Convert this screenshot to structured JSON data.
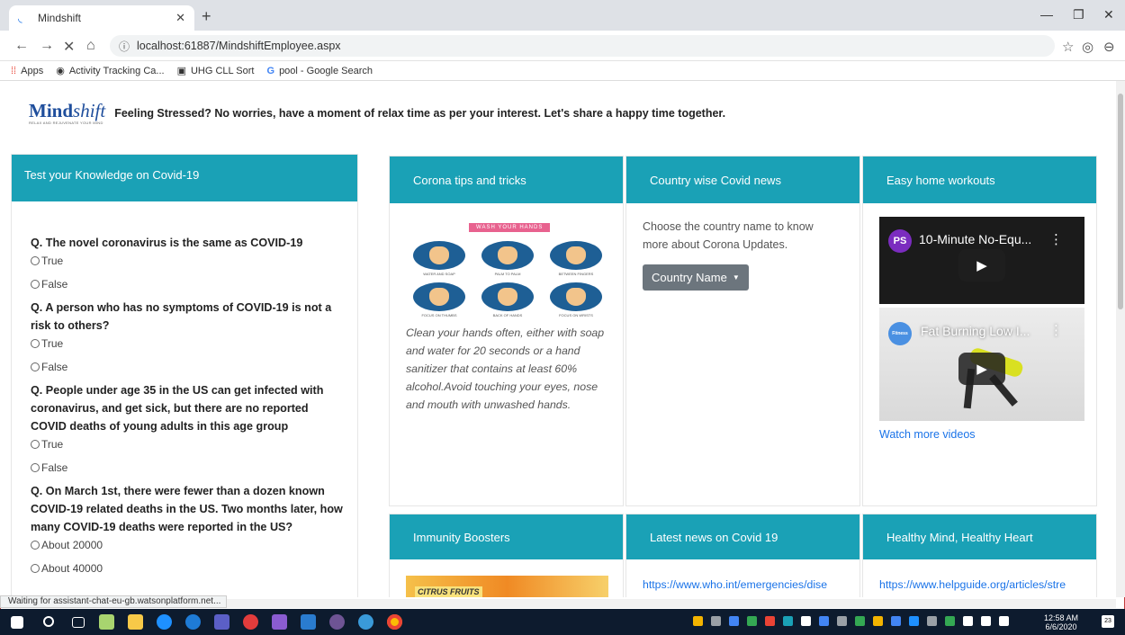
{
  "browser": {
    "tab_title": "Mindshift",
    "url": "localhost:61887/MindshiftEmployee.aspx",
    "bookmarks": [
      "Apps",
      "Activity Tracking Ca...",
      "UHG CLL Sort",
      "pool - Google Search"
    ],
    "status_text": "Waiting for assistant-chat-eu-gb.watsonplatform.net..."
  },
  "header": {
    "logo_part1": "Mind",
    "logo_part2": "shift",
    "logo_sub": "RELAX AND REJUVENATE YOUR MIND",
    "tagline": "Feeling Stressed? No worries, have a moment of relax time as per your interest. Let's share a happy time together."
  },
  "quiz": {
    "title": "Test your Knowledge on Covid-19",
    "questions": [
      {
        "text": "Q. The novel coronavirus is the same as COVID-19",
        "options": [
          "True",
          "False"
        ]
      },
      {
        "text": "Q. A person who has no symptoms of COVID-19 is not a risk to others?",
        "options": [
          "True",
          "False"
        ]
      },
      {
        "text": "Q. People under age 35 in the US can get infected with coronavirus, and get sick, but there are no reported COVID deaths of young adults in this age group",
        "options": [
          "True",
          "False"
        ]
      },
      {
        "text": "Q. On March 1st, there were fewer than a dozen known COVID-19 related deaths in the US. Two months later, how many COVID-19 deaths were reported in the US?",
        "options": [
          "About 20000",
          "About 40000"
        ]
      }
    ]
  },
  "tips": {
    "title": "Corona tips and tricks",
    "banner": "WASH YOUR HANDS",
    "captions": [
      "WATER AND SOAP",
      "PALM TO PALM",
      "BETWEEN FINGERS",
      "FOCUS ON THUMBS",
      "BACK OF HANDS",
      "FOCUS ON WRISTS"
    ],
    "text": "Clean your hands often, either with soap and water for 20 seconds or a hand sanitizer that contains at least 60% alcohol.Avoid touching your eyes, nose and mouth with unwashed hands."
  },
  "news": {
    "title": "Country wise Covid news",
    "text": "Choose the country name to know more about Corona Updates.",
    "dropdown": "Country Name"
  },
  "workouts": {
    "title": "Easy home workouts",
    "video1": {
      "badge": "PS",
      "title": "10-Minute No-Equ..."
    },
    "video2": {
      "badge": "Fitness",
      "title": "Fat Burning Low I..."
    },
    "more": "Watch more videos"
  },
  "immunity": {
    "title": "Immunity Boosters",
    "image_label": "CITRUS FRUITS"
  },
  "latest": {
    "title": "Latest news on Covid 19",
    "link": "https://www.who.int/emergencies/dise"
  },
  "mind": {
    "title": "Healthy Mind, Healthy Heart",
    "link": "https://www.helpguide.org/articles/stre"
  },
  "taskbar": {
    "time": "12:58 AM",
    "date": "6/6/2020",
    "notifications": "23"
  }
}
